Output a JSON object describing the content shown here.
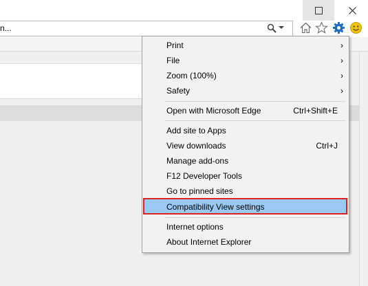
{
  "window": {
    "address_text": "n..."
  },
  "toolbar_icons": [
    "home-icon",
    "favorites-star-icon",
    "tools-gear-icon",
    "feedback-smiley-icon"
  ],
  "colors": {
    "highlight": "#99c9f4",
    "callout_border": "#e0201c",
    "gear": "#1e6fc3",
    "smiley": "#f2c40f"
  },
  "menu": {
    "items": [
      {
        "label": "Print",
        "submenu": true
      },
      {
        "label": "File",
        "submenu": true
      },
      {
        "label": "Zoom (100%)",
        "submenu": true
      },
      {
        "label": "Safety",
        "submenu": true
      },
      {
        "label": "Open with Microsoft Edge",
        "shortcut": "Ctrl+Shift+E"
      },
      {
        "label": "Add site to Apps"
      },
      {
        "label": "View downloads",
        "shortcut": "Ctrl+J"
      },
      {
        "label": "Manage add-ons"
      },
      {
        "label": "F12 Developer Tools"
      },
      {
        "label": "Go to pinned sites"
      },
      {
        "label": "Compatibility View settings",
        "highlighted": true
      },
      {
        "label": "Internet options"
      },
      {
        "label": "About Internet Explorer"
      }
    ],
    "submenu_arrow": "›"
  }
}
